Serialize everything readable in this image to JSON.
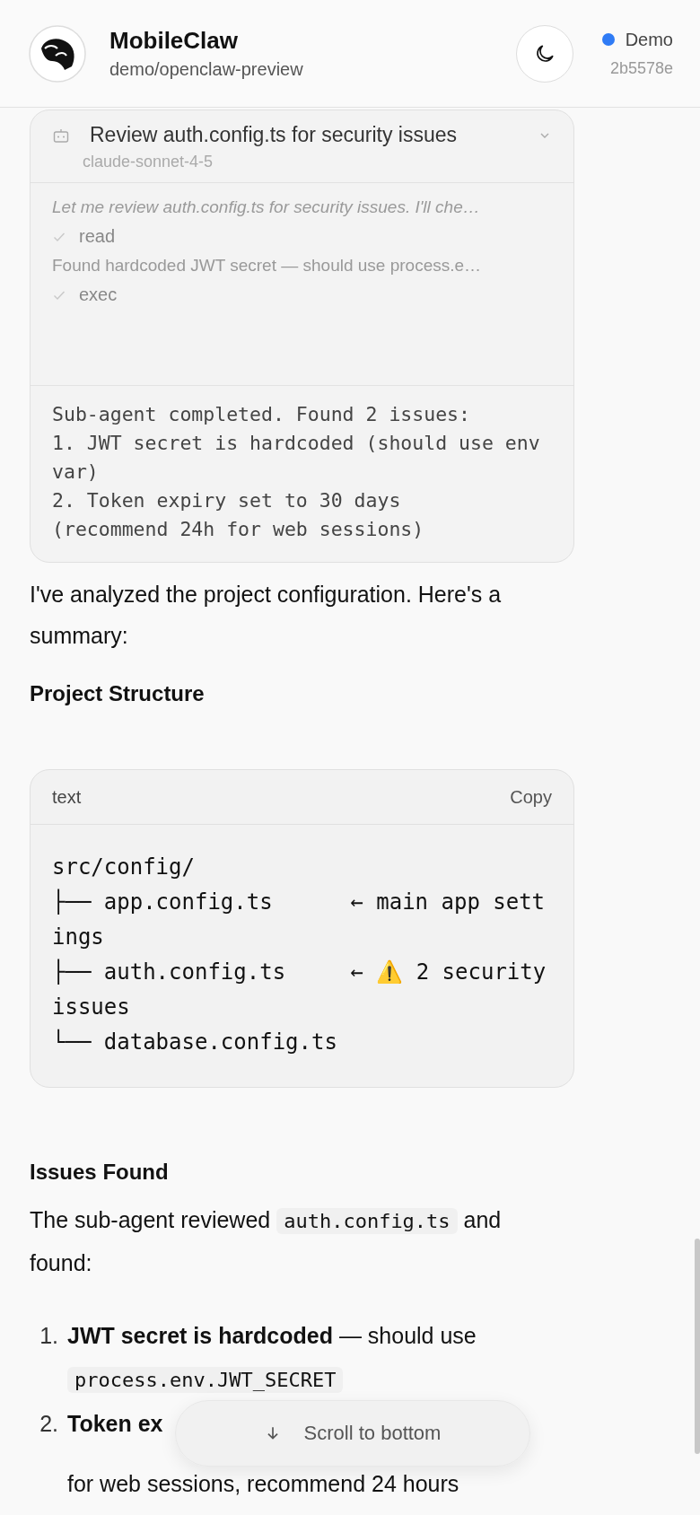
{
  "header": {
    "title": "MobileClaw",
    "subtitle": "demo/openclaw-preview",
    "status": {
      "label": "Demo",
      "online": true
    },
    "commit": "2b5578e"
  },
  "subagent": {
    "title": "Review auth.config.ts for security issues",
    "model": "claude-sonnet-4-5",
    "steps": [
      {
        "kind": "thinking",
        "text": "Let me review auth.config.ts for security issues. I'll che…"
      },
      {
        "kind": "tool",
        "text": "read",
        "done": true
      },
      {
        "kind": "result",
        "text": "Found hardcoded JWT secret — should use process.e…"
      },
      {
        "kind": "tool",
        "text": "exec",
        "done": true
      }
    ],
    "output": "Sub-agent completed. Found 2 issues:\n1. JWT secret is hardcoded (should use env var)\n2. Token expiry set to 30 days\n(recommend 24h for web sessions)"
  },
  "blocks": [
    {
      "kind": "paragraph",
      "text": "I've analyzed the project configuration. Here's a summary:"
    },
    {
      "kind": "heading",
      "text": "Project Structure"
    },
    {
      "kind": "code",
      "language": "text",
      "copy": "Copy",
      "lines": [
        "src/config/",
        "├── app.config.ts      ← main app settings",
        "├── auth.config.ts     ← ⚠️ 2 security issues",
        "└── database.config.ts"
      ]
    },
    {
      "kind": "heading",
      "text": "Issues Found"
    },
    {
      "kind": "paragraph_code",
      "before": "The sub-agent reviewed ",
      "code": "auth.config.ts",
      "after": " and found:"
    },
    {
      "kind": "list",
      "items": [
        {
          "number": "1.",
          "bold": "JWT secret is hardcoded",
          "text": " — should use ",
          "code": "process.env.JWT_SECRET"
        },
        {
          "number": "2.",
          "bold": "Token ex",
          "text": "for web sessions, recommend 24 hours"
        }
      ]
    }
  ],
  "scroll_button": "Scroll to bottom"
}
